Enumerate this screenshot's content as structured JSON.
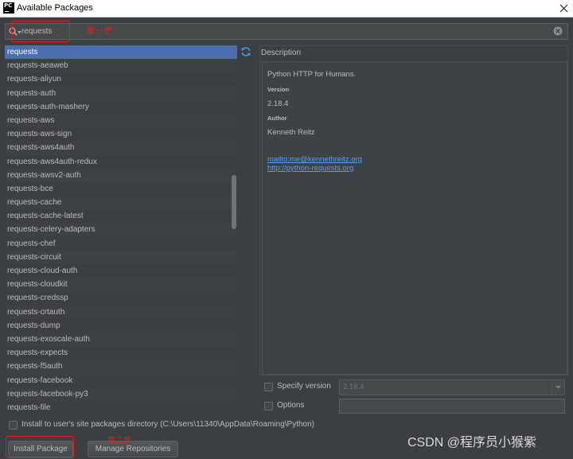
{
  "window": {
    "title": "Available Packages",
    "app_icon": "pycharm-icon",
    "app_icon_text": "PC",
    "close_icon": "close-icon"
  },
  "search": {
    "value": "requests",
    "icon": "search-icon",
    "history_icon": "chevron-down-icon",
    "clear_icon": "clear-icon"
  },
  "annotations": {
    "step1": "第一步",
    "step2": "第二步"
  },
  "packages": {
    "selected_index": 0,
    "refresh_icon": "refresh-icon",
    "items": [
      "requests",
      "requests-aeaweb",
      "requests-aliyun",
      "requests-auth",
      "requests-auth-mashery",
      "requests-aws",
      "requests-aws-sign",
      "requests-aws4auth",
      "requests-aws4auth-redux",
      "requests-awsv2-auth",
      "requests-bce",
      "requests-cache",
      "requests-cache-latest",
      "requests-celery-adapters",
      "requests-chef",
      "requests-circuit",
      "requests-cloud-auth",
      "requests-cloudkit",
      "requests-credssp",
      "requests-crtauth",
      "requests-dump",
      "requests-exoscale-auth",
      "requests-expects",
      "requests-f5auth",
      "requests-facebook",
      "requests-facebook-py3",
      "requests-file"
    ]
  },
  "description": {
    "header": "Description",
    "summary": "Python HTTP for Humans.",
    "version_label": "Version",
    "version": "2.18.4",
    "author_label": "Author",
    "author": "Kenneth Reitz",
    "links": [
      "mailto:me@kennethreitz.org",
      "http://python-requests.org"
    ]
  },
  "options": {
    "specify_version_label": "Specify version",
    "specify_version_checked": false,
    "version_value": "2.18.4",
    "dropdown_icon": "chevron-down-icon",
    "options_label": "Options",
    "options_checked": false
  },
  "install_user": {
    "label": "Install to user's site packages directory (C:\\Users\\11340\\AppData\\Roaming\\Python)",
    "checked": false
  },
  "buttons": {
    "install": "Install Package",
    "manage": "Manage Repositories"
  },
  "watermark": {
    "text": "CSDN @程序员小猴紫"
  },
  "colors": {
    "panel_bg": "#3c3f41",
    "text": "#bbbbbb",
    "selection": "#4b6eaf",
    "link": "#589df6",
    "annotation": "#e02020"
  }
}
